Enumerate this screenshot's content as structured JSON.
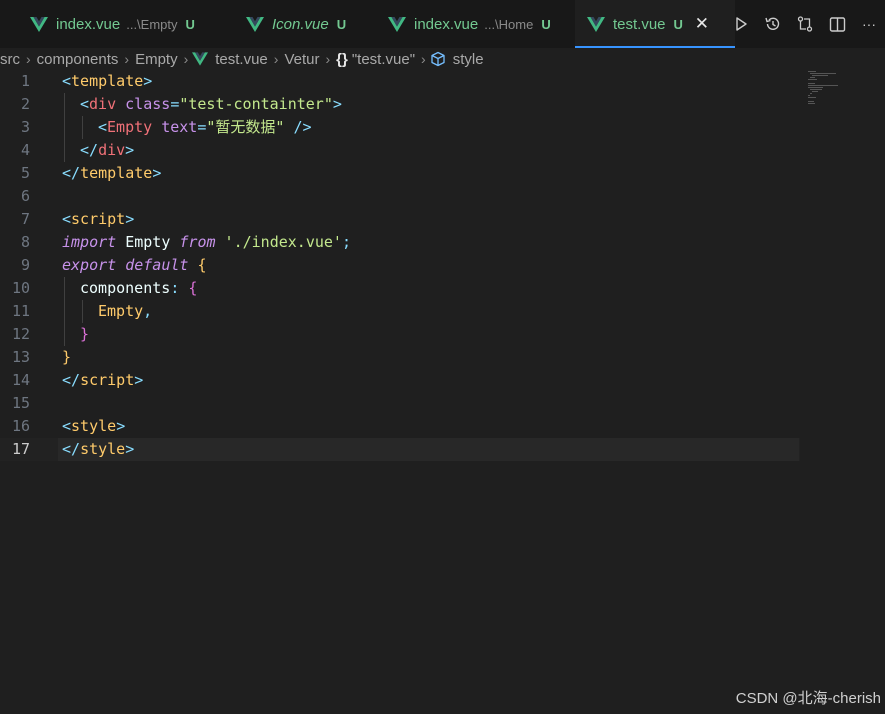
{
  "tabs": [
    {
      "name": "index.vue",
      "desc": "...\\Empty",
      "badge": "U",
      "italic": false,
      "active": false
    },
    {
      "name": "Icon.vue",
      "desc": "",
      "badge": "U",
      "italic": true,
      "active": false
    },
    {
      "name": "index.vue",
      "desc": "...\\Home",
      "badge": "U",
      "italic": false,
      "active": false
    },
    {
      "name": "test.vue",
      "desc": "",
      "badge": "U",
      "italic": false,
      "active": true,
      "close": "✕"
    }
  ],
  "actions": [
    "run-icon",
    "timeline-icon",
    "compare-changes-icon",
    "split-editor-icon",
    "more-icon"
  ],
  "more_label": "···",
  "breadcrumb": {
    "src": "src",
    "components": "components",
    "empty": "Empty",
    "file": "test.vue",
    "vetur": "Vetur",
    "braces": "{}",
    "object": "\"test.vue\"",
    "style": "style"
  },
  "code": {
    "line_numbers": [
      "1",
      "2",
      "3",
      "4",
      "5",
      "6",
      "7",
      "8",
      "9",
      "10",
      "11",
      "12",
      "13",
      "14",
      "15",
      "16",
      "17"
    ],
    "l1": {
      "open": "<",
      "tag": "template",
      "close": ">"
    },
    "l2": {
      "open": "<",
      "tag": "div",
      "attr": "class",
      "eq": "=",
      "val": "\"test-containter\"",
      "close": ">"
    },
    "l3": {
      "open": "<",
      "tag": "Empty",
      "attr": "text",
      "eq": "=",
      "val": "\"暂无数据\"",
      "close": " />"
    },
    "l4": {
      "open": "</",
      "tag": "div",
      "close": ">"
    },
    "l5": {
      "open": "</",
      "tag": "template",
      "close": ">"
    },
    "l7": {
      "open": "<",
      "tag": "script",
      "close": ">"
    },
    "l8": {
      "kw1": "import",
      "name": " Empty ",
      "kw2": "from",
      "str": " './index.vue'",
      "semi": ";"
    },
    "l9": {
      "kw1": "export",
      "kw2": "default",
      "brace": "{"
    },
    "l10": {
      "key": "components",
      "colon": ":",
      "brace": "{"
    },
    "l11": {
      "name": "Empty",
      "comma": ","
    },
    "l12": {
      "brace": "}"
    },
    "l13": {
      "brace": "}"
    },
    "l14": {
      "open": "</",
      "tag": "script",
      "close": ">"
    },
    "l16": {
      "open": "<",
      "tag": "style",
      "close": ">"
    },
    "l17": {
      "open": "</",
      "tag": "style",
      "close": ">"
    }
  },
  "watermark": "CSDN @北海-cherish",
  "colors": {
    "accent": "#3794ff",
    "untracked": "#73c991",
    "vue": "#41b883"
  }
}
